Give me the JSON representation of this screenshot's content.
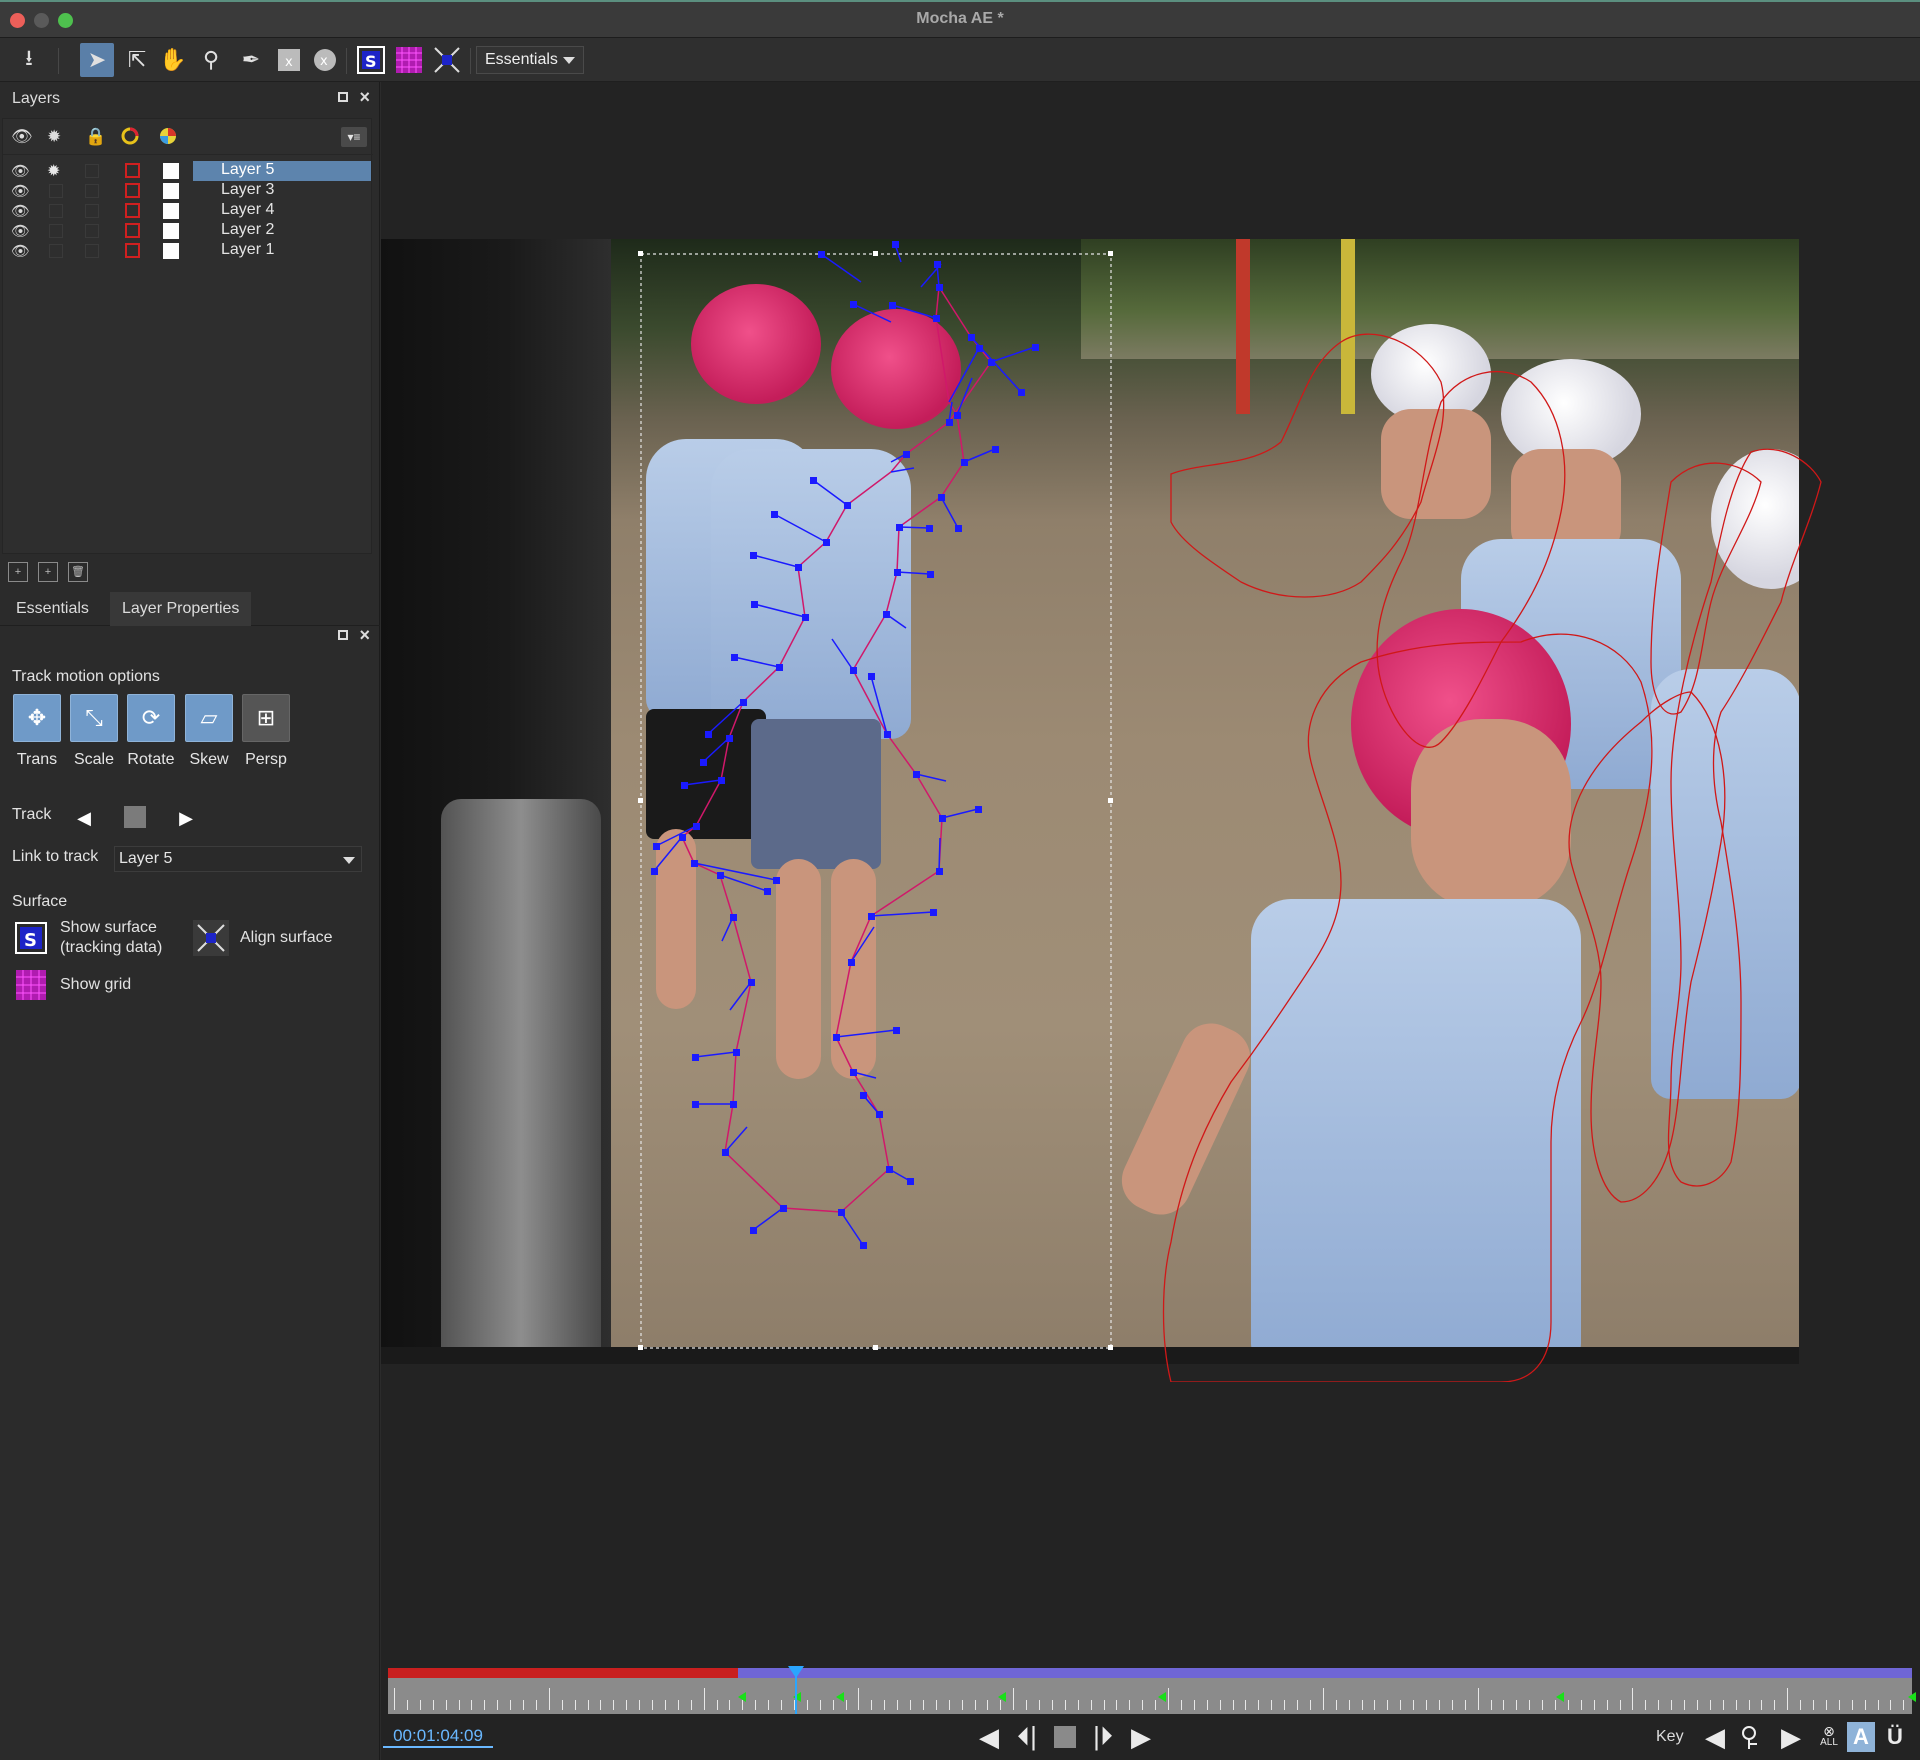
{
  "window": {
    "title": "Mocha AE *"
  },
  "toolbar": {
    "workspace_value": "Essentials",
    "tools": [
      "save-icon",
      "pick-tool-icon",
      "add-point-icon",
      "hand-icon",
      "zoom-icon",
      "pen-icon",
      "x-spline-icon",
      "bezier-icon",
      "surface-icon",
      "grid-icon",
      "align-icon"
    ]
  },
  "layers_panel": {
    "title": "Layers",
    "layers": [
      {
        "name": "Layer 5",
        "selected": true
      },
      {
        "name": "Layer 3",
        "selected": false
      },
      {
        "name": "Layer 4",
        "selected": false
      },
      {
        "name": "Layer 2",
        "selected": false
      },
      {
        "name": "Layer 1",
        "selected": false
      }
    ]
  },
  "tabs": {
    "essentials": "Essentials",
    "layer_properties": "Layer Properties"
  },
  "properties": {
    "track_motion_title": "Track motion options",
    "motion_options": [
      {
        "label": "Trans",
        "on": true
      },
      {
        "label": "Scale",
        "on": true
      },
      {
        "label": "Rotate",
        "on": true
      },
      {
        "label": "Skew",
        "on": true
      },
      {
        "label": "Persp",
        "on": false
      }
    ],
    "track_label": "Track",
    "link_label": "Link to track",
    "link_value": "Layer 5",
    "surface_title": "Surface",
    "show_surface_line1": "Show surface",
    "show_surface_line2": "(tracking data)",
    "align_surface": "Align surface",
    "show_grid": "Show grid"
  },
  "timeline": {
    "timecode": "00:01:04:09",
    "key_label": "Key",
    "all_label": "ALL",
    "auto_key": "A",
    "u_label": "Ü"
  },
  "colors": {
    "accent": "#5d84ad",
    "spline_blue": "#1a1aff",
    "spline_red": "#d01818",
    "range_red": "#c81f1f",
    "range_purple": "#6f66d6",
    "playhead": "#2aa6ff",
    "keyframe": "#19e019"
  }
}
